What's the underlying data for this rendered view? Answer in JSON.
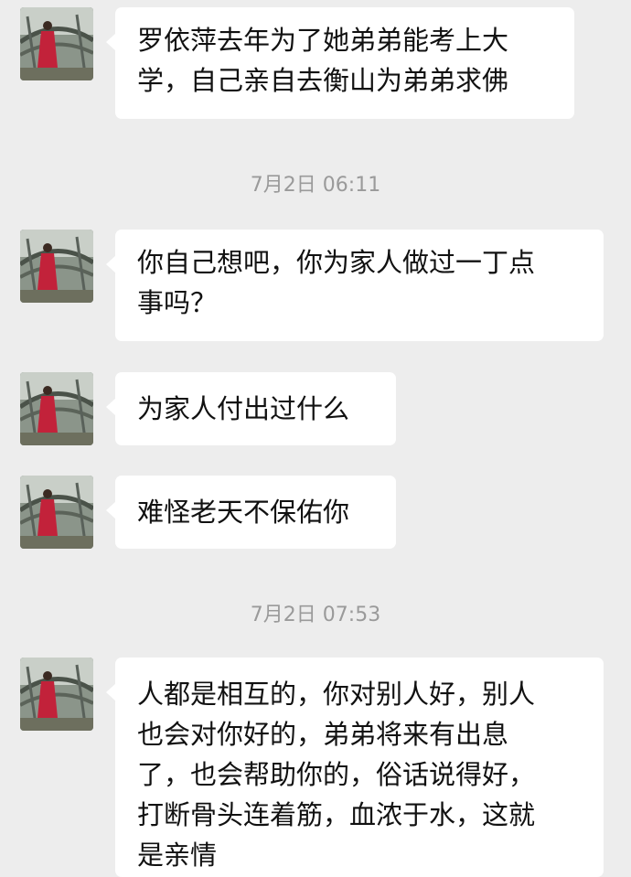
{
  "messages": [
    {
      "lines": [
        "罗依萍去年为了她弟弟能考上大",
        "学，自己亲自去衡山为弟弟求佛"
      ]
    },
    {
      "lines": [
        "你自己想吧，你为家人做过一丁点",
        "事吗？"
      ]
    },
    {
      "lines": [
        "为家人付出过什么"
      ]
    },
    {
      "lines": [
        "难怪老天不保佑你"
      ]
    },
    {
      "lines": [
        "人都是相互的，你对别人好，别人",
        "也会对你好的，弟弟将来有出息",
        "了，也会帮助你的，俗话说得好，",
        "打断骨头连着筋，血浓于水，这就",
        "是亲情"
      ]
    }
  ],
  "timestamps": [
    "7月2日 06:11",
    "7月2日 07:53"
  ],
  "colors": {
    "background": "#ededed",
    "bubble": "#ffffff",
    "timestamp": "#9a9a9a"
  },
  "icons": {
    "avatar": "avatar-photo"
  }
}
